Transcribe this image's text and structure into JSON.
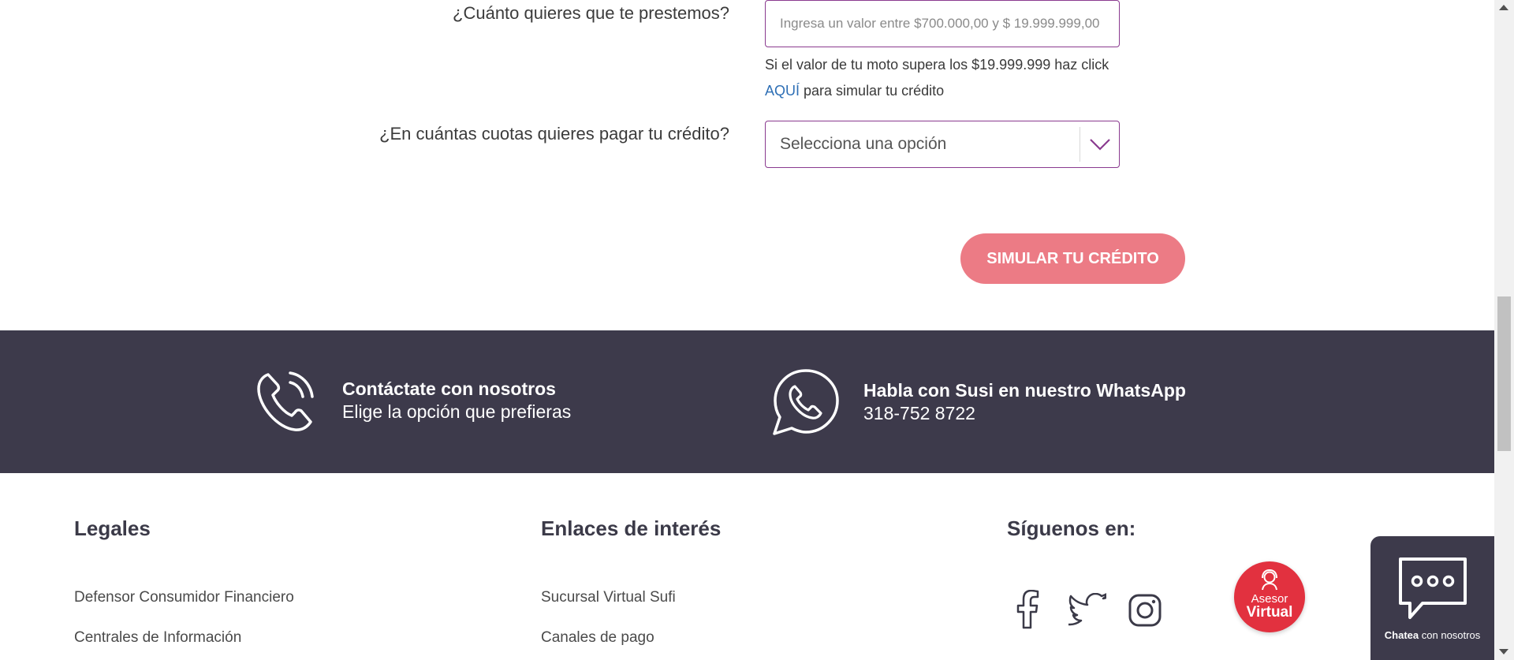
{
  "form": {
    "amount_question": "¿Cuánto quieres que te prestemos?",
    "amount_placeholder": "Ingresa un valor entre $700.000,00 y $ 19.999.999,00",
    "help_text_prefix": "Si el valor de tu moto supera los $19.999.999 haz click",
    "help_link": "AQUÍ",
    "help_text_suffix": "para simular tu crédito",
    "installments_question": "¿En cuántas cuotas quieres pagar tu crédito?",
    "installments_selected": "Selecciona una opción",
    "simulate_button": "SIMULAR TU CRÉDITO"
  },
  "contact": {
    "phone_title": "Contáctate con nosotros",
    "phone_sub": "Elige la opción que prefieras",
    "whatsapp_title": "Habla con Susi en nuestro WhatsApp",
    "whatsapp_number": "318-752 8722"
  },
  "footer": {
    "legales_heading": "Legales",
    "legales_links": [
      "Defensor Consumidor Financiero",
      "Centrales de Información"
    ],
    "enlaces_heading": "Enlaces de interés",
    "enlaces_links": [
      "Sucursal Virtual Sufi",
      "Canales de pago"
    ],
    "siguenos_heading": "Síguenos en:"
  },
  "asesor": {
    "line1": "Asesor",
    "line2": "Virtual"
  },
  "chat": {
    "bold": "Chatea",
    "rest": "con nosotros"
  },
  "colors": {
    "accent_purple": "#8a3a8f",
    "button_pink": "#ec7b85",
    "band_dark": "#3d3a4b",
    "asesor_red": "#e2313f",
    "link_blue": "#2e6fb5"
  },
  "icons": [
    "phone-icon",
    "whatsapp-icon",
    "facebook-icon",
    "twitter-icon",
    "instagram-icon",
    "asesor-icon",
    "chat-bubble-icon",
    "chevron-down-icon"
  ]
}
